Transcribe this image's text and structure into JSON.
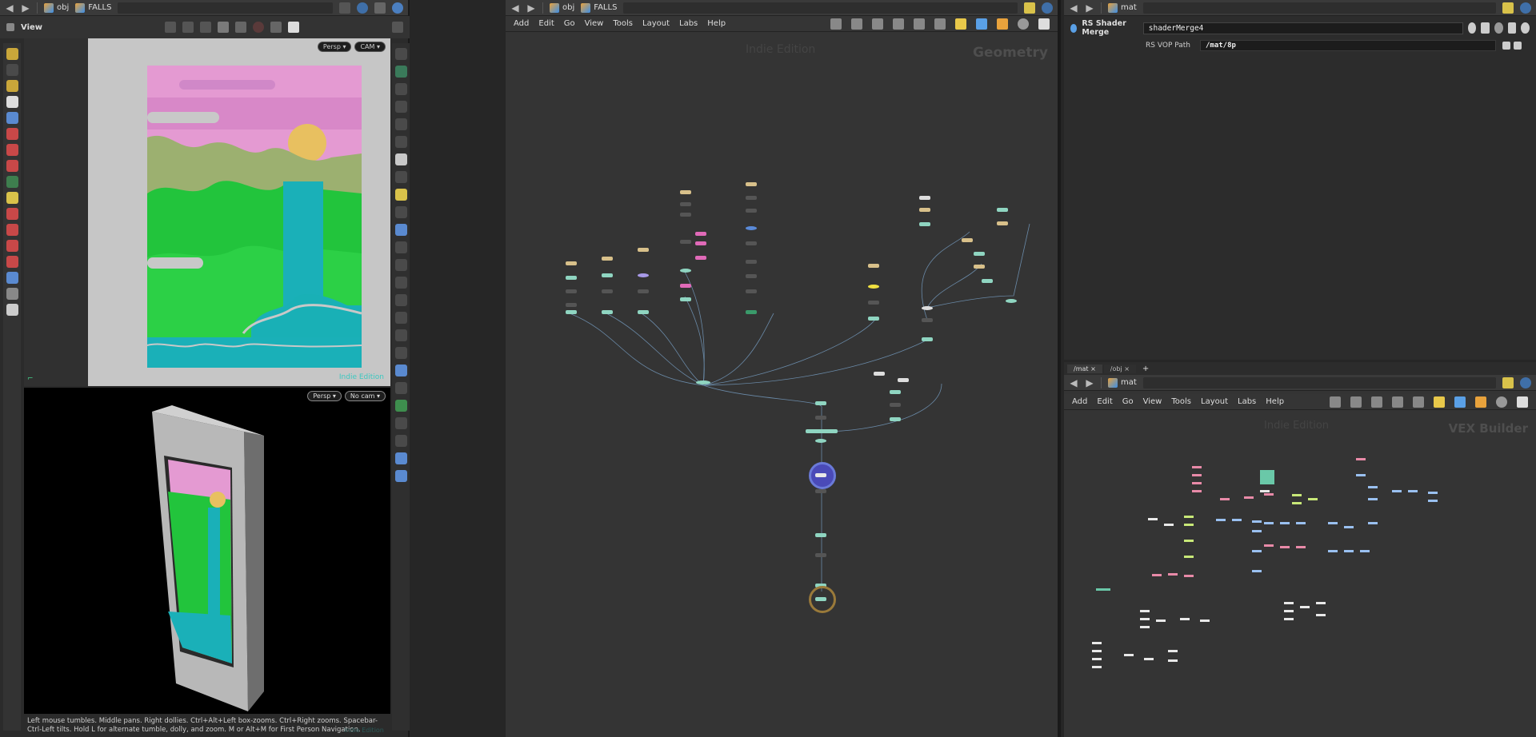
{
  "left_pane": {
    "path_root": "obj",
    "path_node": "FALLS",
    "viewport_title": "View",
    "top_view": {
      "persp_label": "Persp",
      "cam_label": "CAM",
      "watermark": "Indie Edition"
    },
    "bottom_view": {
      "persp_label": "Persp",
      "cam_label": "No cam",
      "watermark": "Indie Edition"
    },
    "status_text": "Left mouse tumbles. Middle pans. Right dollies. Ctrl+Alt+Left box-zooms. Ctrl+Right zooms. Spacebar-Ctrl-Left tilts. Hold L for alternate tumble, dolly, and zoom.    M or Alt+M for First Person Navigation."
  },
  "network_pane": {
    "path_root": "obj",
    "path_node": "FALLS",
    "menu": [
      "Add",
      "Edit",
      "Go",
      "View",
      "Tools",
      "Layout",
      "Labs",
      "Help"
    ],
    "watermark": "Indie Edition",
    "context_label": "Geometry"
  },
  "params_pane": {
    "path_root": "mat",
    "node_type": "RS Shader Merge",
    "node_name": "shaderMerge4",
    "param_label": "RS VOP Path",
    "param_value": "/mat/8p"
  },
  "vex_pane": {
    "tabs": [
      "/mat",
      "/obj"
    ],
    "path_root": "mat",
    "menu": [
      "Add",
      "Edit",
      "Go",
      "View",
      "Tools",
      "Layout",
      "Labs",
      "Help"
    ],
    "watermark": "Indie Edition",
    "context_label": "VEX Builder"
  },
  "colors": {
    "accent": "#5aa0e6",
    "node_green": "#8fd5c1",
    "node_tan": "#d8c08a",
    "node_pink": "#e06ab8",
    "node_yellow": "#f0e040",
    "sky_pink": "#e49ad2",
    "water": "#1ab0b8",
    "land_green": "#22c43c"
  }
}
